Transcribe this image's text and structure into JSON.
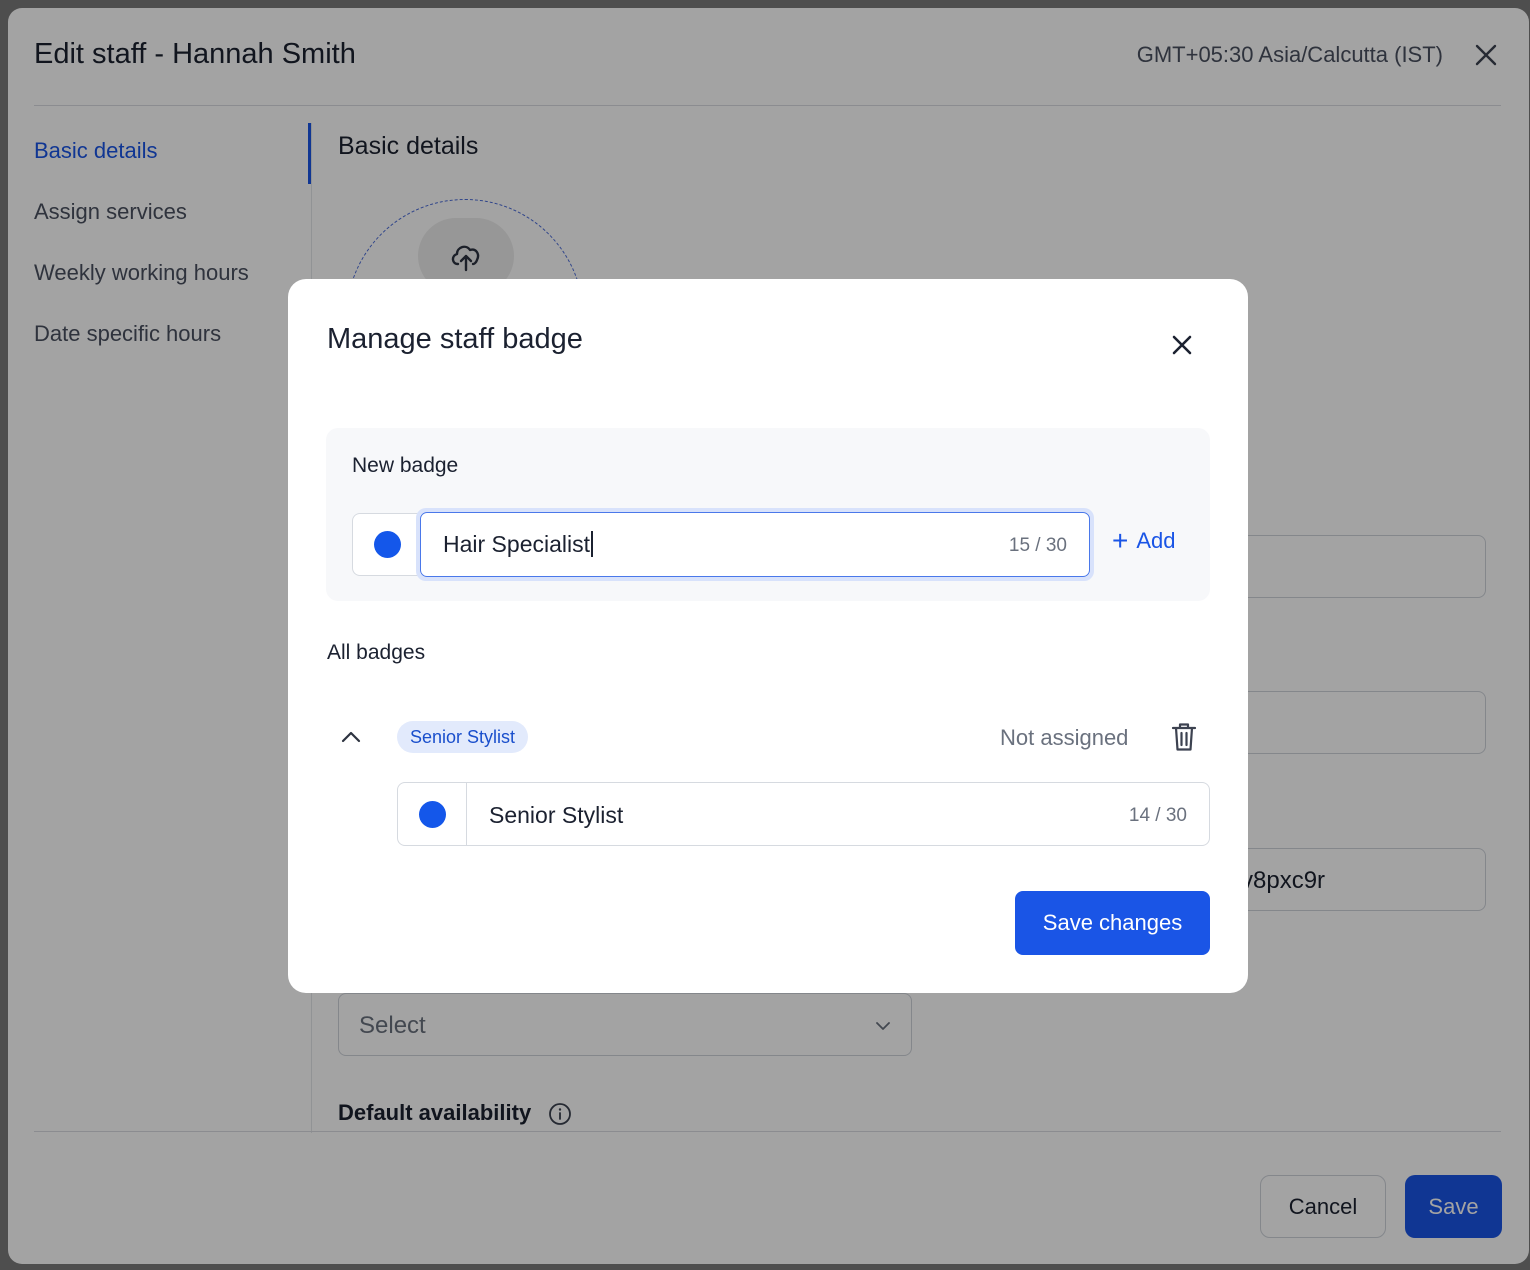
{
  "edit_staff": {
    "title": "Edit staff - Hannah Smith",
    "timezone": "GMT+05:30 Asia/Calcutta (IST)",
    "nav": [
      {
        "label": "Basic details",
        "active": true
      },
      {
        "label": "Assign services",
        "active": false
      },
      {
        "label": "Weekly working hours",
        "active": false
      },
      {
        "label": "Date specific hours",
        "active": false
      }
    ],
    "section_title": "Basic details",
    "partial_field_value": "v8pxc9r",
    "select_placeholder": "Select",
    "default_availability_label": "Default availability",
    "cancel_label": "Cancel",
    "save_label": "Save"
  },
  "modal": {
    "title": "Manage staff badge",
    "new_badge": {
      "label": "New badge",
      "color": "#1457ea",
      "input_value": "Hair Specialist",
      "counter": "15 / 30",
      "add_label": "Add"
    },
    "all_badges_label": "All badges",
    "badges": [
      {
        "name": "Senior Stylist",
        "status": "Not assigned",
        "color": "#1457ea",
        "edit_value": "Senior Stylist",
        "counter": "14 / 30",
        "expanded": true
      }
    ],
    "save_changes_label": "Save changes"
  },
  "colors": {
    "accent": "#1a55e6",
    "pill_bg": "#e2eafc",
    "badge_dot": "#1457ea"
  }
}
